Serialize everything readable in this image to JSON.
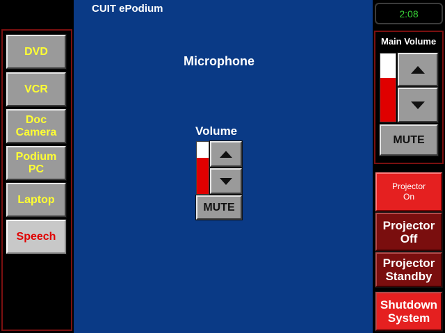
{
  "header": {
    "app_title": "CUIT ePodium",
    "clock": "2:08"
  },
  "sources": [
    {
      "label": "DVD",
      "active": false
    },
    {
      "label": "VCR",
      "active": false
    },
    {
      "label": "Doc\nCamera",
      "active": false
    },
    {
      "label": "Podium\nPC",
      "active": false
    },
    {
      "label": "Laptop",
      "active": false
    },
    {
      "label": "Speech",
      "active": true
    }
  ],
  "main": {
    "section_title": "Microphone",
    "volume_label": "Volume",
    "volume_level": 0.7,
    "mute_label": "MUTE"
  },
  "main_volume": {
    "label": "Main Volume",
    "level": 0.64,
    "mute_label": "MUTE"
  },
  "projector": {
    "on_label": "Projector\nOn",
    "off_label": "Projector\nOff",
    "standby_label": "Projector\nStandby"
  },
  "system": {
    "shutdown_label": "Shutdown\nSystem"
  },
  "colors": {
    "panel_blue": "#0a3a86",
    "accent_yellow": "#ffff33",
    "active_red": "#e52020",
    "clock_green": "#37d337"
  },
  "icons": {
    "up": "triangle-up-icon",
    "down": "triangle-down-icon"
  }
}
